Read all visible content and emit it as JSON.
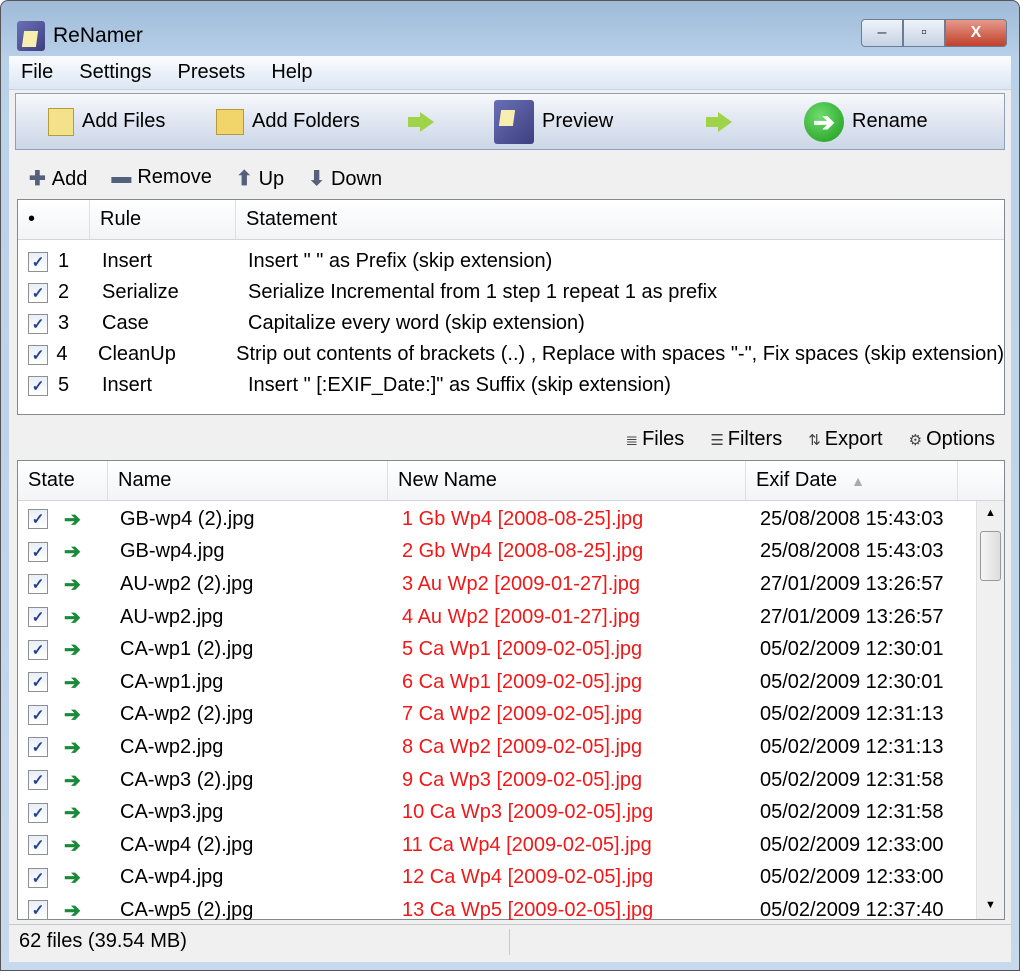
{
  "window": {
    "title": "ReNamer",
    "minimize": "–",
    "maximize": "▫",
    "close": "X"
  },
  "menu": [
    "File",
    "Settings",
    "Presets",
    "Help"
  ],
  "toolbar": {
    "add_files": "Add Files",
    "add_folders": "Add Folders",
    "preview": "Preview",
    "rename": "Rename"
  },
  "rules_toolbar": {
    "add": "Add",
    "remove": "Remove",
    "up": "Up",
    "down": "Down"
  },
  "rules": {
    "headers": [
      "•",
      "Rule",
      "Statement"
    ],
    "rows": [
      {
        "n": "1",
        "rule": "Insert",
        "statement": "Insert \" \" as Prefix (skip extension)"
      },
      {
        "n": "2",
        "rule": "Serialize",
        "statement": "Serialize Incremental from 1 step 1 repeat 1 as prefix"
      },
      {
        "n": "3",
        "rule": "Case",
        "statement": "Capitalize every word (skip extension)"
      },
      {
        "n": "4",
        "rule": "CleanUp",
        "statement": "Strip out contents of brackets (..) , Replace with spaces \"-\", Fix spaces (skip extension)"
      },
      {
        "n": "5",
        "rule": "Insert",
        "statement": "Insert \" [:EXIF_Date:]\" as Suffix (skip extension)"
      }
    ]
  },
  "files_toolbar": {
    "files": "Files",
    "filters": "Filters",
    "export": "Export",
    "options": "Options"
  },
  "files": {
    "headers": [
      "State",
      "Name",
      "New Name",
      "Exif Date"
    ],
    "rows": [
      {
        "name": "GB-wp4 (2).jpg",
        "new": "1 Gb Wp4 [2008-08-25].jpg",
        "date": "25/08/2008 15:43:03"
      },
      {
        "name": "GB-wp4.jpg",
        "new": "2 Gb Wp4 [2008-08-25].jpg",
        "date": "25/08/2008 15:43:03"
      },
      {
        "name": "AU-wp2 (2).jpg",
        "new": "3 Au Wp2 [2009-01-27].jpg",
        "date": "27/01/2009 13:26:57"
      },
      {
        "name": "AU-wp2.jpg",
        "new": "4 Au Wp2 [2009-01-27].jpg",
        "date": "27/01/2009 13:26:57"
      },
      {
        "name": "CA-wp1 (2).jpg",
        "new": "5 Ca Wp1 [2009-02-05].jpg",
        "date": "05/02/2009 12:30:01"
      },
      {
        "name": "CA-wp1.jpg",
        "new": "6 Ca Wp1 [2009-02-05].jpg",
        "date": "05/02/2009 12:30:01"
      },
      {
        "name": "CA-wp2 (2).jpg",
        "new": "7 Ca Wp2 [2009-02-05].jpg",
        "date": "05/02/2009 12:31:13"
      },
      {
        "name": "CA-wp2.jpg",
        "new": "8 Ca Wp2 [2009-02-05].jpg",
        "date": "05/02/2009 12:31:13"
      },
      {
        "name": "CA-wp3 (2).jpg",
        "new": "9 Ca Wp3 [2009-02-05].jpg",
        "date": "05/02/2009 12:31:58"
      },
      {
        "name": "CA-wp3.jpg",
        "new": "10 Ca Wp3 [2009-02-05].jpg",
        "date": "05/02/2009 12:31:58"
      },
      {
        "name": "CA-wp4 (2).jpg",
        "new": "11 Ca Wp4 [2009-02-05].jpg",
        "date": "05/02/2009 12:33:00"
      },
      {
        "name": "CA-wp4.jpg",
        "new": "12 Ca Wp4 [2009-02-05].jpg",
        "date": "05/02/2009 12:33:00"
      },
      {
        "name": "CA-wp5 (2).jpg",
        "new": "13 Ca Wp5 [2009-02-05].jpg",
        "date": "05/02/2009 12:37:40"
      }
    ]
  },
  "status": "62 files (39.54 MB)"
}
